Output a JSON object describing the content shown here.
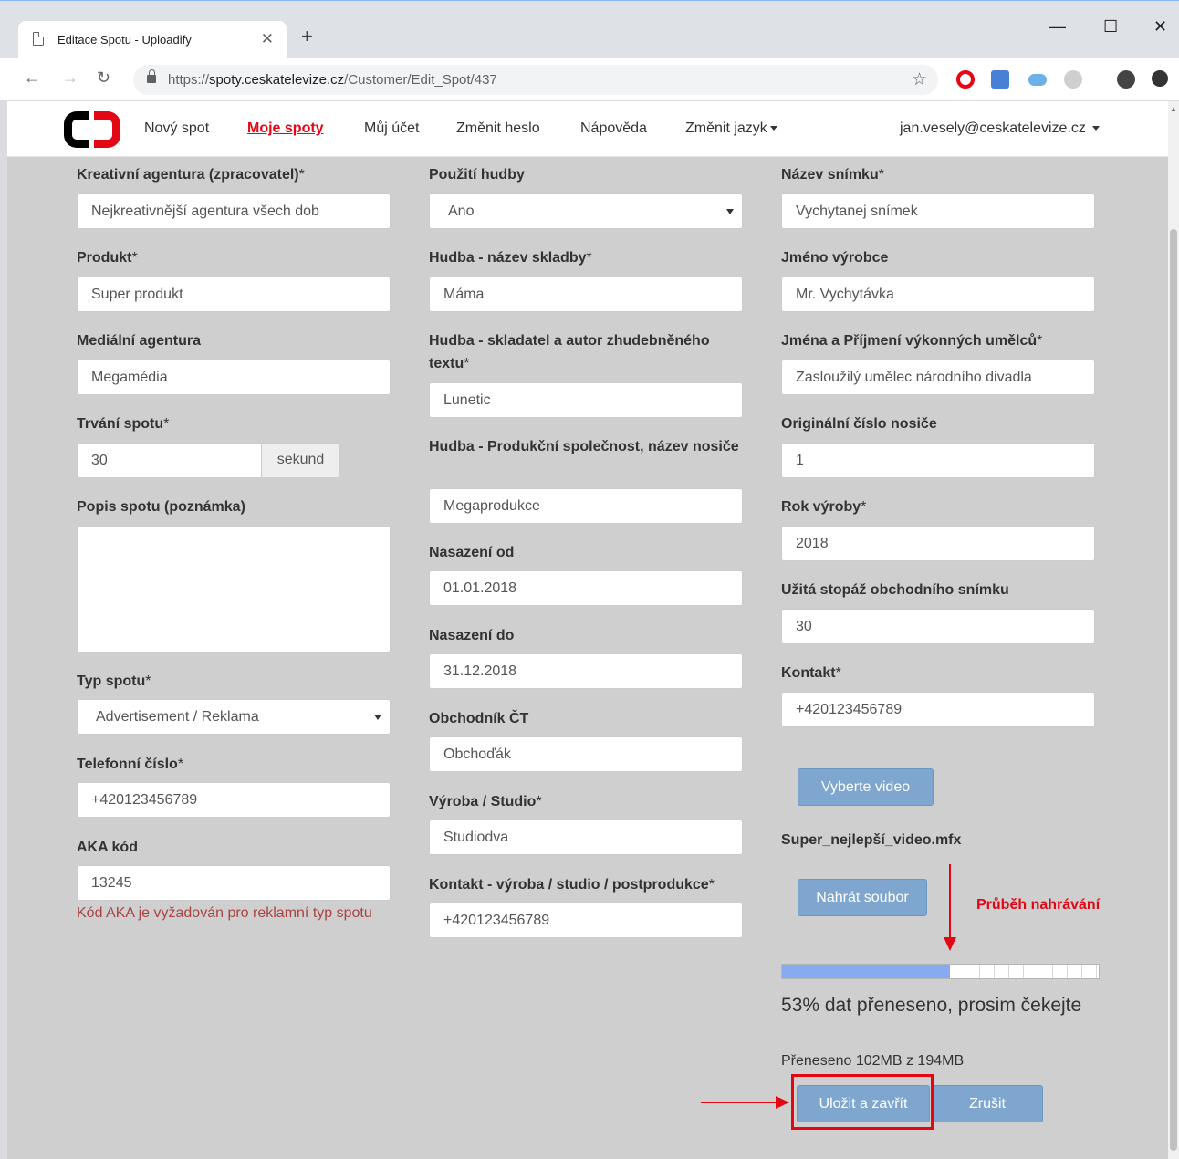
{
  "browser": {
    "tab_title": "Editace Spotu - Uploadify",
    "url_scheme": "https://",
    "url_host": "spoty.ceskatelevize.cz",
    "url_path": "/Customer/Edit_Spot/437"
  },
  "nav": {
    "items": [
      "Nový spot",
      "Moje spoty",
      "Můj účet",
      "Změnit heslo",
      "Nápověda"
    ],
    "language": "Změnit jazyk",
    "user": "jan.vesely@ceskatelevize.cz"
  },
  "col1": {
    "creative_agency": {
      "label": "Kreativní agentura (zpracovatel)",
      "value": "Nejkreativnější agentura všech dob"
    },
    "product": {
      "label": "Produkt",
      "value": "Super produkt"
    },
    "media_agency": {
      "label": "Mediální agentura",
      "value": "Megamédia"
    },
    "duration": {
      "label": "Trvání spotu",
      "value": "30",
      "unit": "sekund"
    },
    "description": {
      "label": "Popis spotu (poznámka)"
    },
    "spot_type": {
      "label": "Typ spotu",
      "value": "Advertisement / Reklama"
    },
    "phone": {
      "label": "Telefonní číslo",
      "value": "+420123456789"
    },
    "aka": {
      "label": "AKA kód",
      "value": "13245",
      "error": "Kód AKA je vyžadován pro reklamní typ spotu"
    }
  },
  "col2": {
    "music_use": {
      "label": "Použití hudby",
      "value": "Ano"
    },
    "music_title": {
      "label": "Hudba - název skladby",
      "value": "Máma"
    },
    "music_composer": {
      "label": "Hudba - skladatel a autor zhudebněného textu",
      "value": "Lunetic"
    },
    "music_company": {
      "label": "Hudba - Produkční společnost, název nosiče",
      "value": "Megaprodukce"
    },
    "from": {
      "label": "Nasazení od",
      "value": "01.01.2018"
    },
    "to": {
      "label": "Nasazení do",
      "value": "31.12.2018"
    },
    "trader": {
      "label": "Obchodník ČT",
      "value": "Obchoďák"
    },
    "studio": {
      "label": "Výroba / Studio",
      "value": "Studiodva"
    },
    "studio_contact": {
      "label": "Kontakt - výroba / studio / postprodukce",
      "value": "+420123456789"
    }
  },
  "col3": {
    "recording_name": {
      "label": "Název snímku",
      "value": "Vychytanej snímek"
    },
    "producer": {
      "label": "Jméno výrobce",
      "value": "Mr. Vychytávka"
    },
    "artists": {
      "label": "Jména a Příjmení výkonných umělců",
      "value": "Zasloužilý umělec národního divadla"
    },
    "carrier": {
      "label": "Originální číslo nosiče",
      "value": "1"
    },
    "year": {
      "label": "Rok výroby",
      "value": "2018"
    },
    "footage": {
      "label": "Užitá stopáž obchodního snímku",
      "value": "30"
    },
    "contact": {
      "label": "Kontakt",
      "value": "+420123456789"
    },
    "select_video": "Vyberte video",
    "filename": "Super_nejlepší_video.mfx",
    "upload_file": "Nahrát soubor",
    "annotation": "Průběh nahrávání",
    "progress": 0.53,
    "progress_text": "53% dat přeneseno, prosim čekejte",
    "transferred": "Přeneseno 102MB z 194MB",
    "save": "Uložit a zavřít",
    "cancel": "Zrušit"
  },
  "required_mark": "*",
  "colors": {
    "accent": "#e30613",
    "button": "#7ea6cf",
    "progress": "#88aaf0"
  }
}
